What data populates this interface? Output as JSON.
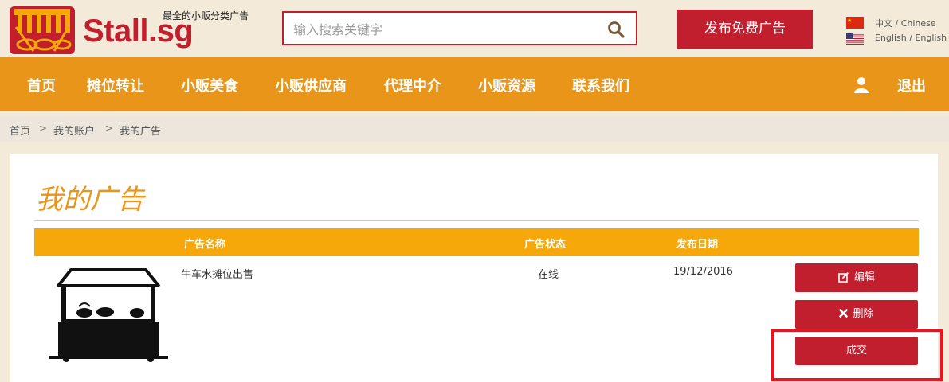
{
  "header": {
    "logo_text": "Stall.sg",
    "tagline": "最全的小贩分类广告",
    "search_placeholder": "输入搜索关键字",
    "post_ad_label": "发布免费广告",
    "languages": [
      {
        "label": "中文 / Chinese",
        "flag": "china-flag-icon"
      },
      {
        "label": "English / English",
        "flag": "us-flag-icon"
      }
    ]
  },
  "nav": {
    "items": [
      {
        "label": "首页"
      },
      {
        "label": "摊位转让"
      },
      {
        "label": "小贩美食"
      },
      {
        "label": "小贩供应商"
      },
      {
        "label": "代理中介"
      },
      {
        "label": "小贩资源"
      },
      {
        "label": "联系我们"
      }
    ],
    "user_icon": "user-icon",
    "logout_label": "退出"
  },
  "breadcrumb": {
    "items": [
      "首页",
      "我的账户",
      "我的广告"
    ],
    "separator": ">"
  },
  "main": {
    "title": "我的广告",
    "table": {
      "headers": [
        "广告名称",
        "广告状态",
        "发布日期"
      ],
      "rows": [
        {
          "image_icon": "hawker-stall-icon",
          "name": "牛车水摊位出售",
          "status": "在线",
          "date": "19/12/2016"
        }
      ]
    },
    "actions": {
      "edit_label": "编辑",
      "delete_label": "删除",
      "deal_label": "成交"
    }
  },
  "colors": {
    "brand_red": "#c21f2e",
    "nav_orange": "#e8951a",
    "header_orange": "#f6a70a",
    "highlight_red": "#e8141e"
  }
}
